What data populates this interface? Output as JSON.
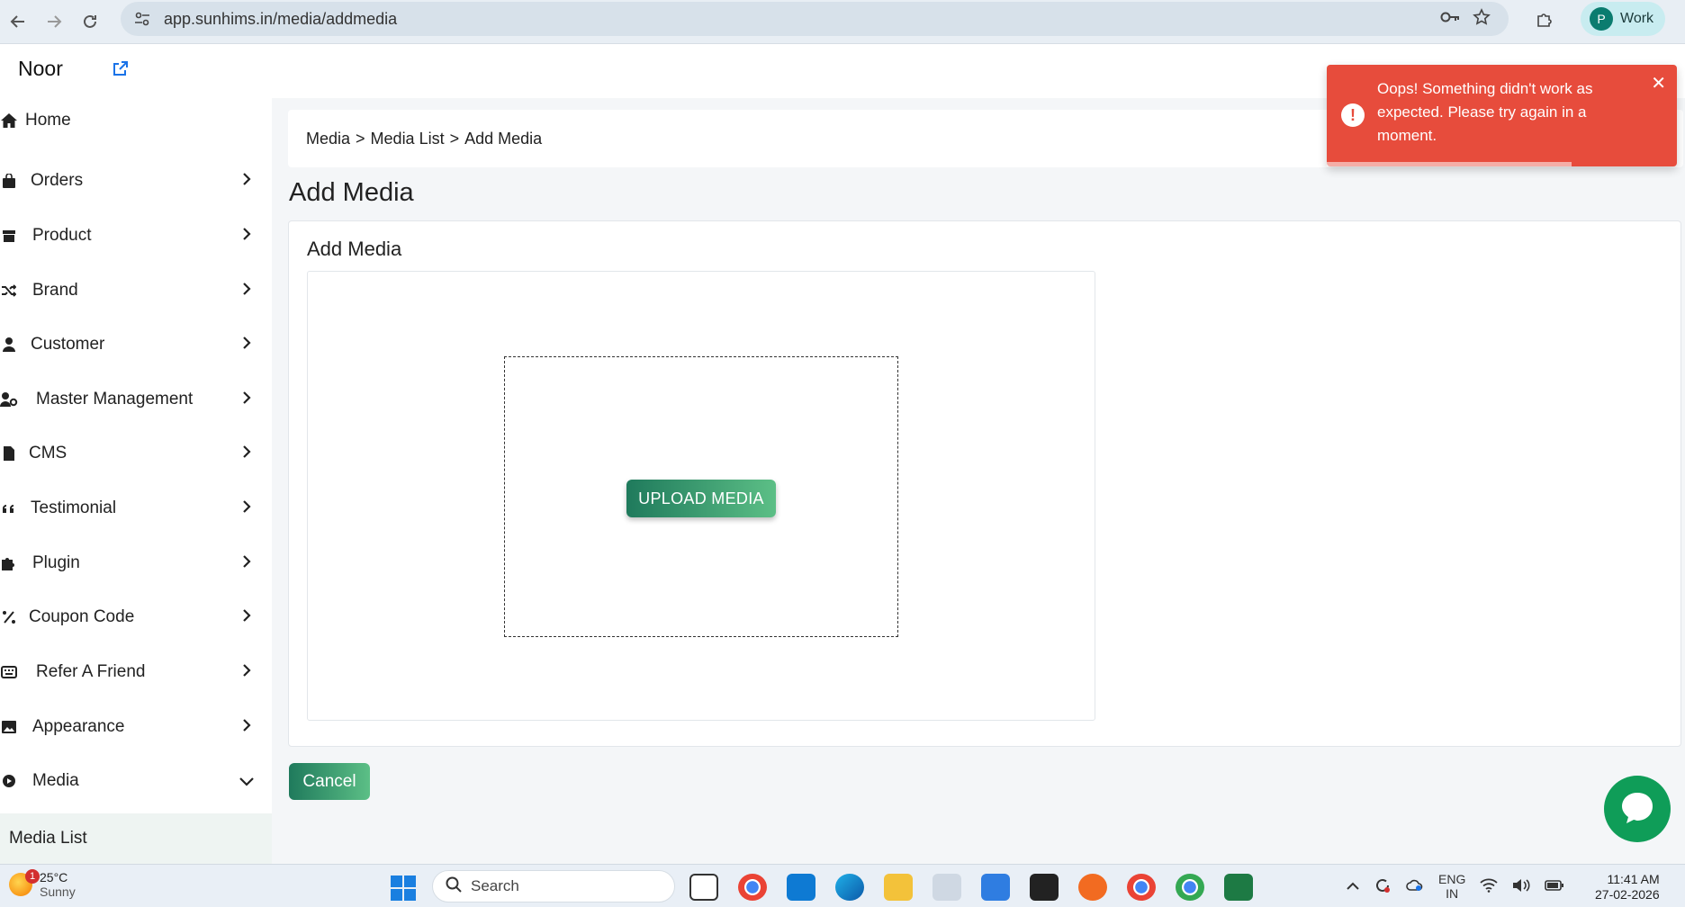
{
  "browser": {
    "url": "app.sunhims.in/media/addmedia",
    "profile_initial": "P",
    "profile_label": "Work"
  },
  "topbar": {
    "brand": "Noor"
  },
  "sidebar": {
    "items": [
      {
        "label": "Home",
        "icon": "home-icon",
        "chevron": "none"
      },
      {
        "label": "Orders",
        "icon": "bag-icon",
        "chevron": "right"
      },
      {
        "label": "Product",
        "icon": "box-icon",
        "chevron": "right"
      },
      {
        "label": "Brand",
        "icon": "shuffle-icon",
        "chevron": "right"
      },
      {
        "label": "Customer",
        "icon": "user-icon",
        "chevron": "right"
      },
      {
        "label": "Master Management",
        "icon": "user-gear-icon",
        "chevron": "right"
      },
      {
        "label": "CMS",
        "icon": "file-icon",
        "chevron": "right"
      },
      {
        "label": "Testimonial",
        "icon": "quote-icon",
        "chevron": "right"
      },
      {
        "label": "Plugin",
        "icon": "puzzle-icon",
        "chevron": "right"
      },
      {
        "label": "Coupon Code",
        "icon": "percent-icon",
        "chevron": "right"
      },
      {
        "label": "Refer A Friend",
        "icon": "keyboard-icon",
        "chevron": "right"
      },
      {
        "label": "Appearance",
        "icon": "image-icon",
        "chevron": "right"
      },
      {
        "label": "Media",
        "icon": "play-icon",
        "chevron": "down"
      }
    ],
    "sub_item": "Media List"
  },
  "breadcrumb": {
    "items": [
      "Media",
      "Media List",
      "Add Media"
    ],
    "separator": ">"
  },
  "page": {
    "title": "Add Media",
    "card_title": "Add Media",
    "upload_label": "UPLOAD MEDIA",
    "cancel_label": "Cancel"
  },
  "toast": {
    "message": "Oops! Something didn't work as expected. Please try again in a moment.",
    "close": "✕",
    "error_symbol": "!",
    "progress": 0.7
  },
  "taskbar": {
    "weather_temp": "25°C",
    "weather_cond": "Sunny",
    "weather_badge": "1",
    "search_label": "Search",
    "lang_top": "ENG",
    "lang_bottom": "IN",
    "time": "11:41 AM",
    "date": "27-02-2026"
  },
  "colors": {
    "accent_green": "#1f7a5c",
    "toast_red": "#e74c3c",
    "chat_green": "#0f9d58"
  }
}
